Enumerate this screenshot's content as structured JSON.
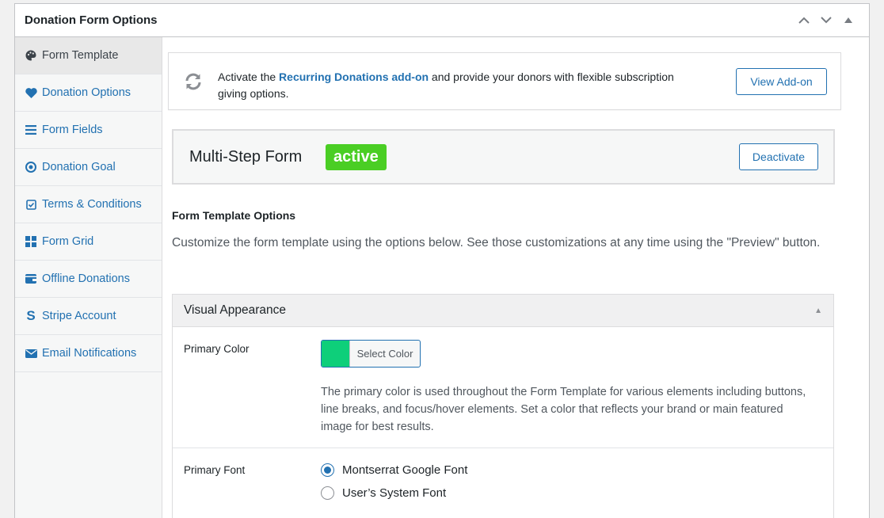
{
  "metabox": {
    "title": "Donation Form Options"
  },
  "sidebar": {
    "items": [
      {
        "label": "Form Template",
        "icon": "palette-icon"
      },
      {
        "label": "Donation Options",
        "icon": "heart-icon"
      },
      {
        "label": "Form Fields",
        "icon": "list-icon"
      },
      {
        "label": "Donation Goal",
        "icon": "target-icon"
      },
      {
        "label": "Terms & Conditions",
        "icon": "checkbox-icon"
      },
      {
        "label": "Form Grid",
        "icon": "grid-icon"
      },
      {
        "label": "Offline Donations",
        "icon": "wallet-icon"
      },
      {
        "label": "Stripe Account",
        "icon": "stripe-icon"
      },
      {
        "label": "Email Notifications",
        "icon": "envelope-icon"
      }
    ]
  },
  "notice": {
    "prefix": "Activate the ",
    "link": "Recurring Donations add-on",
    "suffix": " and provide your donors with flexible subscription giving options.",
    "button": "View Add-on"
  },
  "template": {
    "name": "Multi-Step Form",
    "status": "active",
    "button": "Deactivate"
  },
  "options": {
    "title": "Form Template Options",
    "description": "Customize the form template using the options below. See those customizations at any time using the \"Preview\" button."
  },
  "panel": {
    "title": "Visual Appearance",
    "primary_color": {
      "label": "Primary Color",
      "button": "Select Color",
      "value": "#0ecf7a",
      "description": "The primary color is used throughout the Form Template for various elements including buttons, line breaks, and focus/hover elements. Set a color that reflects your brand or main featured image for best results."
    },
    "primary_font": {
      "label": "Primary Font",
      "options": [
        "Montserrat Google Font",
        "User’s System Font"
      ],
      "selected": "Montserrat Google Font"
    }
  },
  "colors": {
    "link": "#2271b1",
    "active_badge": "#4ace24",
    "swatch": "#0ecf7a"
  }
}
